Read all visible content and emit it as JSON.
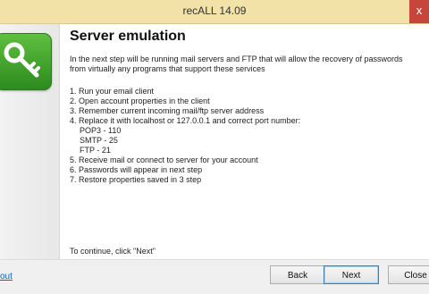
{
  "window": {
    "title": "recALL 14.09",
    "close_glyph": "x"
  },
  "page": {
    "heading": "Server emulation",
    "intro": "In the next step will be running mail servers and FTP that will allow the recovery of passwords from virtually any programs that support these services",
    "steps": [
      "1. Run your email client",
      "2. Open account properties in the client",
      "3. Remember current incoming mail/ftp server address",
      "4. Replace it with localhost or 127.0.0.1 and correct port number:"
    ],
    "ports": [
      "POP3 - 110",
      "SMTP - 25",
      "FTP - 21"
    ],
    "steps_after": [
      "5. Receive mail or connect to server for your account",
      "6. Passwords will appear in next step",
      "7. Restore properties saved in 3 step"
    ],
    "footer_note": "To continue, click \"Next\""
  },
  "bottom": {
    "about_link": "out",
    "back_label": "Back",
    "next_label": "Next",
    "close_label": "Close"
  },
  "icon": {
    "name": "key-icon",
    "accent": "#3ea52a"
  }
}
